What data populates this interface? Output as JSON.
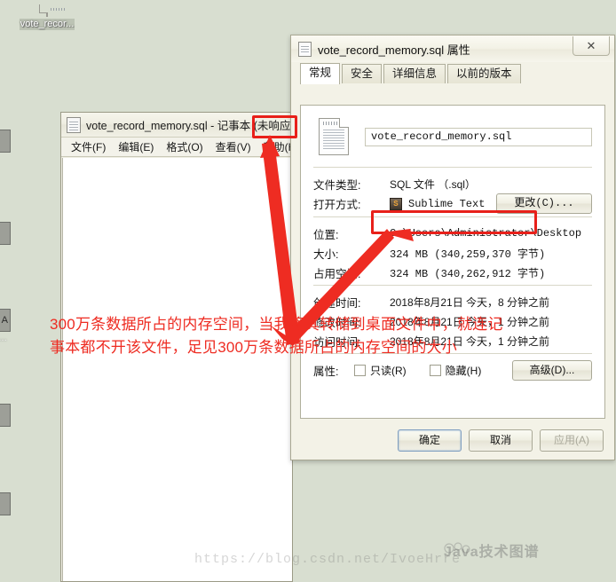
{
  "desktop": {
    "background_color": "#d8ded0",
    "icons": [
      {
        "label": "vote_recor...",
        "icon": "text-file-icon"
      }
    ],
    "edge_icons": [
      {
        "label": "",
        "glyph": ""
      },
      {
        "label": "A",
        "glyph": "A"
      },
      {
        "label": "",
        "glyph": ""
      },
      {
        "label": "",
        "glyph": ""
      }
    ]
  },
  "notepad": {
    "icon": "notepad-icon",
    "title": "vote_record_memory.sql - 记事本 (未响应)",
    "menu": [
      "文件(F)",
      "编辑(E)",
      "格式(O)",
      "查看(V)",
      "帮助(H)"
    ]
  },
  "properties_dialog": {
    "icon": "file-icon",
    "title": "vote_record_memory.sql 属性",
    "close_label": "✕",
    "tabs": [
      {
        "label": "常规",
        "active": true
      },
      {
        "label": "安全",
        "active": false
      },
      {
        "label": "详细信息",
        "active": false
      },
      {
        "label": "以前的版本",
        "active": false
      }
    ],
    "filename": "vote_record_memory.sql",
    "fields": {
      "filetype_label": "文件类型:",
      "filetype_value": "SQL 文件 （.sql）",
      "openwith_label": "打开方式:",
      "openwith_value": "Sublime Text",
      "change_button": "更改(C)...",
      "location_label": "位置:",
      "location_value": "C:\\Users\\Administrator\\Desktop",
      "size_label": "大小:",
      "size_value": "324 MB (340,259,370 字节)",
      "ondisk_label": "占用空间:",
      "ondisk_value": "324 MB (340,262,912 字节)",
      "created_label": "创建时间:",
      "created_value": "2018年8月21日 今天，8 分钟之前",
      "modified_label": "修改时间:",
      "modified_value": "2018年8月21日 今天，1 分钟之前",
      "accessed_label": "访问时间:",
      "accessed_value": "2018年8月21日 今天，1 分钟之前",
      "attributes_label": "属性:",
      "readonly_checkbox": "只读(R)",
      "hidden_checkbox": "隐藏(H)",
      "advanced_button": "高级(D)..."
    },
    "footer_buttons": [
      {
        "label": "确定",
        "state": "default"
      },
      {
        "label": "取消",
        "state": "normal"
      },
      {
        "label": "应用(A)",
        "state": "disabled"
      }
    ]
  },
  "annotations": {
    "color": "#ee2c22",
    "line1": "300万条数据所占的内存空间，当我将其转储到桌面文件中，就连记",
    "line2": "事本都不开该文件，足见300万条数据所占的内存空间的大小",
    "highlight_not_responding": "(未响应)",
    "highlight_size": "324 MB (340,259,370 字节)"
  },
  "watermark": {
    "url": "https://blog.csdn.net/IvoeHrre",
    "logo_text": "Java技术图谱"
  }
}
